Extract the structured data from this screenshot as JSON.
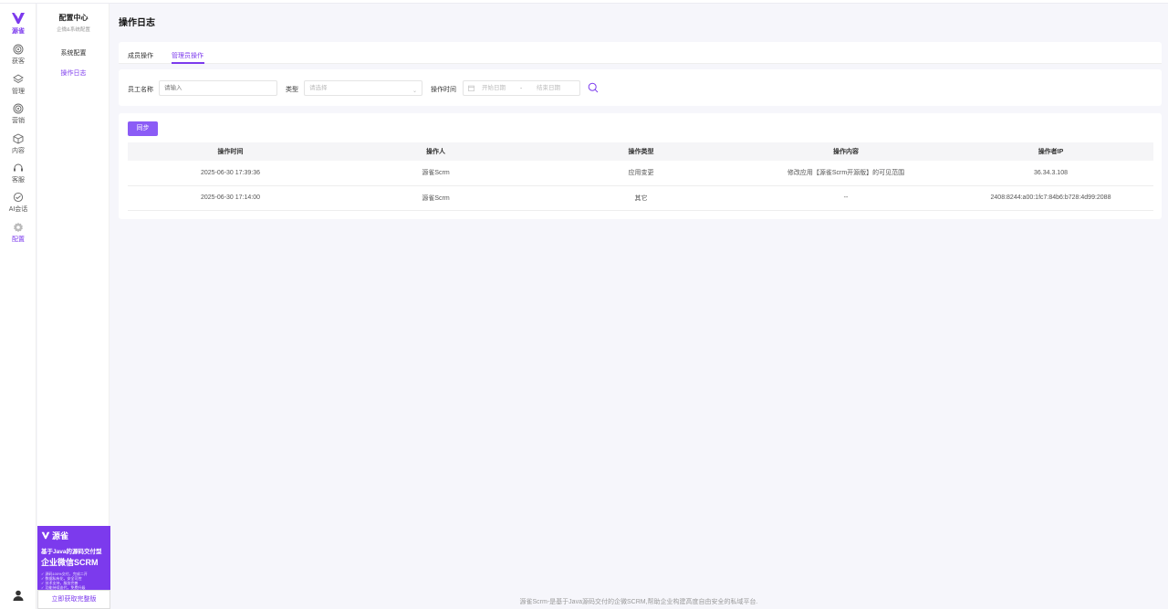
{
  "brand": {
    "name": "源雀",
    "accent": "#7c3aed"
  },
  "rail": {
    "items": [
      {
        "label": "获客",
        "icon": "target-icon"
      },
      {
        "label": "管理",
        "icon": "layers-icon"
      },
      {
        "label": "营销",
        "icon": "target-icon"
      },
      {
        "label": "内容",
        "icon": "cube-icon"
      },
      {
        "label": "客服",
        "icon": "headset-icon"
      },
      {
        "label": "AI会话",
        "icon": "chat-icon"
      },
      {
        "label": "配置",
        "icon": "gear-icon",
        "active": true
      }
    ]
  },
  "submenu": {
    "title": "配置中心",
    "subtitle": "企微&系统配置",
    "items": [
      {
        "label": "系统配置"
      },
      {
        "label": "操作日志",
        "active": true
      }
    ]
  },
  "promo": {
    "brand": "源雀",
    "line1": "基于Java的源码交付型",
    "line2": "企业微信SCRM",
    "bullets": [
      "✓ 源码100%交付，完成二开",
      "✓ 数据私有化，安全可控",
      "✓ 技术支持，服务完善",
      "✓ 功能持续迭代，免费升级"
    ],
    "button": "立即获取完整版"
  },
  "page": {
    "title": "操作日志"
  },
  "tabs": [
    {
      "label": "成员操作"
    },
    {
      "label": "管理员操作",
      "active": true
    }
  ],
  "filters": {
    "employee_label": "员工名称",
    "employee_placeholder": "请输入",
    "type_label": "类型",
    "type_placeholder": "请选择",
    "time_label": "操作时间",
    "start_placeholder": "开始日期",
    "separator": "-",
    "end_placeholder": "结束日期"
  },
  "sync_button": "同步",
  "table": {
    "columns": [
      "操作时间",
      "操作人",
      "操作类型",
      "操作内容",
      "操作者IP"
    ],
    "rows": [
      [
        "2025-06-30 17:39:36",
        "源雀Scrm",
        "应用变更",
        "修改应用【源雀Scrm开源版】的可见范围",
        "36.34.3.108"
      ],
      [
        "2025-06-30 17:14:00",
        "源雀Scrm",
        "其它",
        "--",
        "2408:8244:a00:1fc7:84b6:b728:4d99:2088"
      ]
    ]
  },
  "footer": "源雀Scrm-是基于Java源码交付的企微SCRM,帮助企业构建高度自由安全的私域平台."
}
